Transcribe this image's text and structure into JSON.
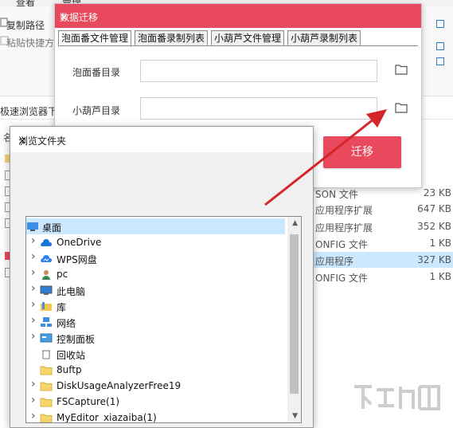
{
  "explorer": {
    "ribbon_tabs": [
      "查看",
      "管理"
    ],
    "copy_path_label": "复制路径",
    "paste_shortcut_label": "粘贴快捷方",
    "address_text": "极速浏览器下",
    "column_letter": "名",
    "files": [
      {
        "type": "SON 文件",
        "size": "23 KB",
        "selected": false
      },
      {
        "type": "应用程序扩展",
        "size": "647 KB",
        "selected": false
      },
      {
        "type": "应用程序扩展",
        "size": "352 KB",
        "selected": false
      },
      {
        "type": "ONFIG 文件",
        "size": "1 KB",
        "selected": false
      },
      {
        "type": "应用程序",
        "size": "327 KB",
        "selected": true
      },
      {
        "type": "ONFIG 文件",
        "size": "1 KB",
        "selected": false
      }
    ]
  },
  "migrate_dialog": {
    "title": "数据迁移",
    "close_glyph": "✕",
    "tabs": [
      "泡面番文件管理",
      "泡面番录制列表",
      "小葫芦文件管理",
      "小葫芦录制列表"
    ],
    "active_tab": 0,
    "paomianfan_dir_label": "泡面番目录",
    "paomianfan_dir_value": "",
    "xiaohulu_dir_label": "小葫芦目录",
    "xiaohulu_dir_value": "",
    "migrate_button": "迁移"
  },
  "browse_dialog": {
    "title": "浏览文件夹",
    "close_glyph": "✕",
    "tree": [
      {
        "label": "桌面",
        "icon": "desktop-icon",
        "expandable": false,
        "indent": 0,
        "selected": true
      },
      {
        "label": "OneDrive",
        "icon": "onedrive-cloud-icon",
        "expandable": true,
        "indent": 1,
        "selected": false
      },
      {
        "label": "WPS网盘",
        "icon": "wps-cloud-icon",
        "expandable": true,
        "indent": 1,
        "selected": false
      },
      {
        "label": "pc",
        "icon": "user-icon",
        "expandable": true,
        "indent": 1,
        "selected": false
      },
      {
        "label": "此电脑",
        "icon": "computer-icon",
        "expandable": true,
        "indent": 1,
        "selected": false
      },
      {
        "label": "库",
        "icon": "library-icon",
        "expandable": true,
        "indent": 1,
        "selected": false
      },
      {
        "label": "网络",
        "icon": "network-icon",
        "expandable": true,
        "indent": 1,
        "selected": false
      },
      {
        "label": "控制面板",
        "icon": "control-panel-icon",
        "expandable": true,
        "indent": 1,
        "selected": false
      },
      {
        "label": "回收站",
        "icon": "recycle-bin-icon",
        "expandable": false,
        "indent": 1,
        "selected": false
      },
      {
        "label": "8uftp",
        "icon": "folder-icon",
        "expandable": false,
        "indent": 1,
        "selected": false
      },
      {
        "label": "DiskUsageAnalyzerFree19",
        "icon": "folder-icon",
        "expandable": true,
        "indent": 1,
        "selected": false
      },
      {
        "label": "FSCapture(1)",
        "icon": "folder-icon",
        "expandable": true,
        "indent": 1,
        "selected": false
      },
      {
        "label": "MyEditor_xiazaiba(1)",
        "icon": "folder-icon",
        "expandable": true,
        "indent": 1,
        "selected": false
      }
    ]
  },
  "colors": {
    "accent": "#e8495c",
    "arrow": "#d4262a",
    "selection": "#cce8ff"
  }
}
